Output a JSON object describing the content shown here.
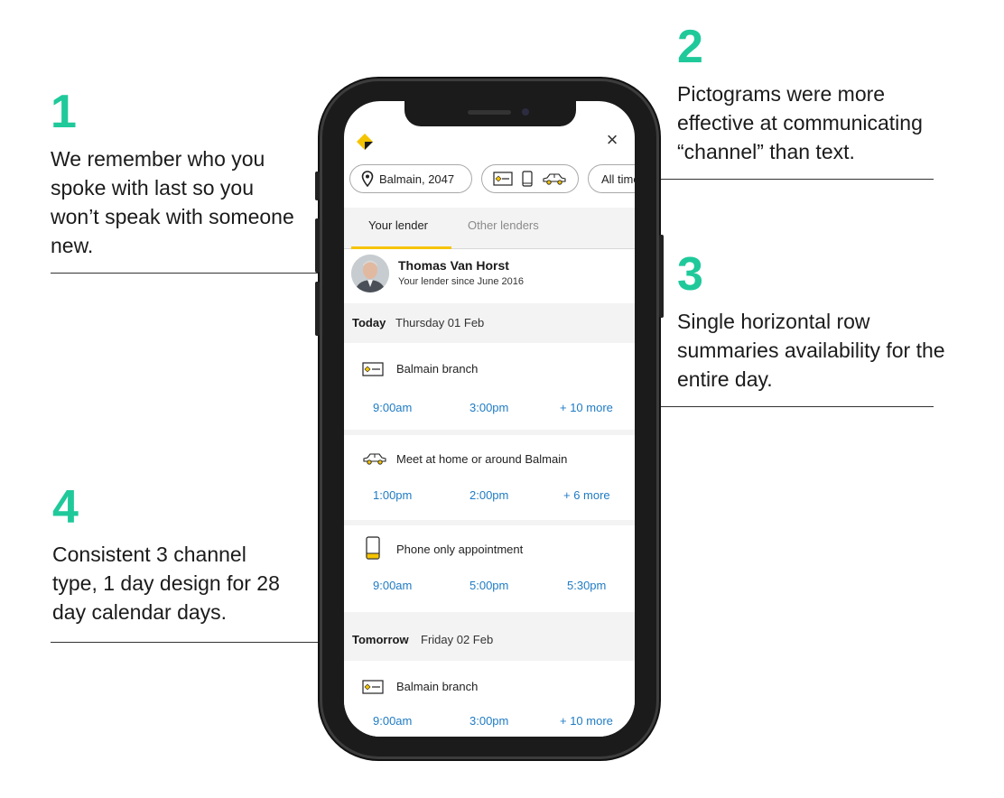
{
  "annotations": [
    {
      "number": "1",
      "text": "We remember who you spoke with last so you won’t speak with someone new."
    },
    {
      "number": "2",
      "text": "Pictograms were more effective at communicating “channel” than text."
    },
    {
      "number": "3",
      "text": "Single horizontal row summaries availability for the entire day."
    },
    {
      "number": "4",
      "text": "Consistent 3 channel type, 1 day design for 28 day calendar days."
    }
  ],
  "app": {
    "close_glyph": "×",
    "filters": {
      "location": "Balmain, 2047",
      "time": "All times"
    },
    "tabs": [
      {
        "label": "Your lender",
        "active": true
      },
      {
        "label": "Other lenders",
        "active": false
      }
    ],
    "lender": {
      "name": "Thomas Van Horst",
      "since": "Your lender since June 2016"
    },
    "days": [
      {
        "label": "Today",
        "date": "Thursday 01 Feb",
        "cards": [
          {
            "icon": "branch-icon",
            "title": "Balmain branch",
            "slots": [
              "9:00am",
              "3:00pm",
              "+ 10 more"
            ]
          },
          {
            "icon": "car-icon",
            "title": "Meet at home or around Balmain",
            "slots": [
              "1:00pm",
              "2:00pm",
              "+ 6 more"
            ]
          },
          {
            "icon": "phone-icon",
            "title": "Phone only appointment",
            "slots": [
              "9:00am",
              "5:00pm",
              "5:30pm"
            ]
          }
        ]
      },
      {
        "label": "Tomorrow",
        "date": "Friday 02 Feb",
        "cards": [
          {
            "icon": "branch-icon",
            "title": "Balmain branch",
            "slots": [
              "9:00am",
              "3:00pm",
              "+ 10 more"
            ]
          }
        ]
      }
    ]
  },
  "colors": {
    "accent": "#1fc99a",
    "brand_yellow": "#f5c400",
    "link": "#1f7bc4"
  }
}
